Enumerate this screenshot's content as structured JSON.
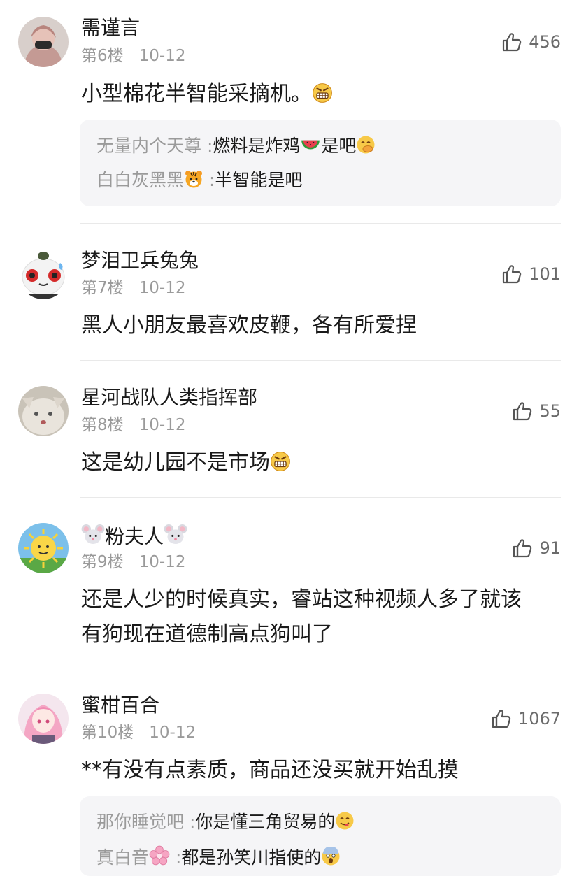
{
  "comments": [
    {
      "username": "需谨言",
      "floor": "第6楼",
      "date": "10-12",
      "likes": "456",
      "content": "小型棉花半智能采摘机。",
      "content_emoji": "grimacing-face",
      "replies": [
        {
          "name": "无量内个天尊",
          "sep": ":",
          "text": "燃料是炸鸡",
          "emoji": "watermelon",
          "text2": "是吧",
          "emoji2": "face-with-hand-over-mouth"
        },
        {
          "name": "白白灰黑黑",
          "name_emoji": "tiger-face",
          "sep": ":",
          "text": "半智能是吧"
        }
      ]
    },
    {
      "username": "梦泪卫兵兔兔",
      "floor": "第7楼",
      "date": "10-12",
      "likes": "101",
      "content": "黑人小朋友最喜欢皮鞭，各有所爱捏"
    },
    {
      "username": "星河战队人类指挥部",
      "floor": "第8楼",
      "date": "10-12",
      "likes": "55",
      "content": "这是幼儿园不是市场",
      "content_emoji": "grimacing-face"
    },
    {
      "username": "粉夫人",
      "username_emoji": "mouse-face",
      "floor": "第9楼",
      "date": "10-12",
      "likes": "91",
      "content_line1": "还是人少的时候真实，睿站这种视频人多了就该",
      "content_line2": "有狗现在道德制高点狗叫了"
    },
    {
      "username": "蜜柑百合",
      "floor": "第10楼",
      "date": "10-12",
      "likes": "1067",
      "content": "**有没有点素质，商品还没买就开始乱摸",
      "replies": [
        {
          "name": "那你睡觉吧",
          "sep": ":",
          "text": "你是懂三角贸易的",
          "emoji": "face-savoring-food"
        },
        {
          "name": "真白音",
          "name_emoji": "cherry-blossom",
          "sep": ":",
          "text": "都是孙笑川指使的",
          "emoji": "face-screaming"
        }
      ]
    }
  ],
  "colors": {
    "name": "#1a1a1a",
    "meta": "#9a9a9a",
    "reply_bg": "#f5f5f7",
    "divider": "#e9e9e9"
  }
}
